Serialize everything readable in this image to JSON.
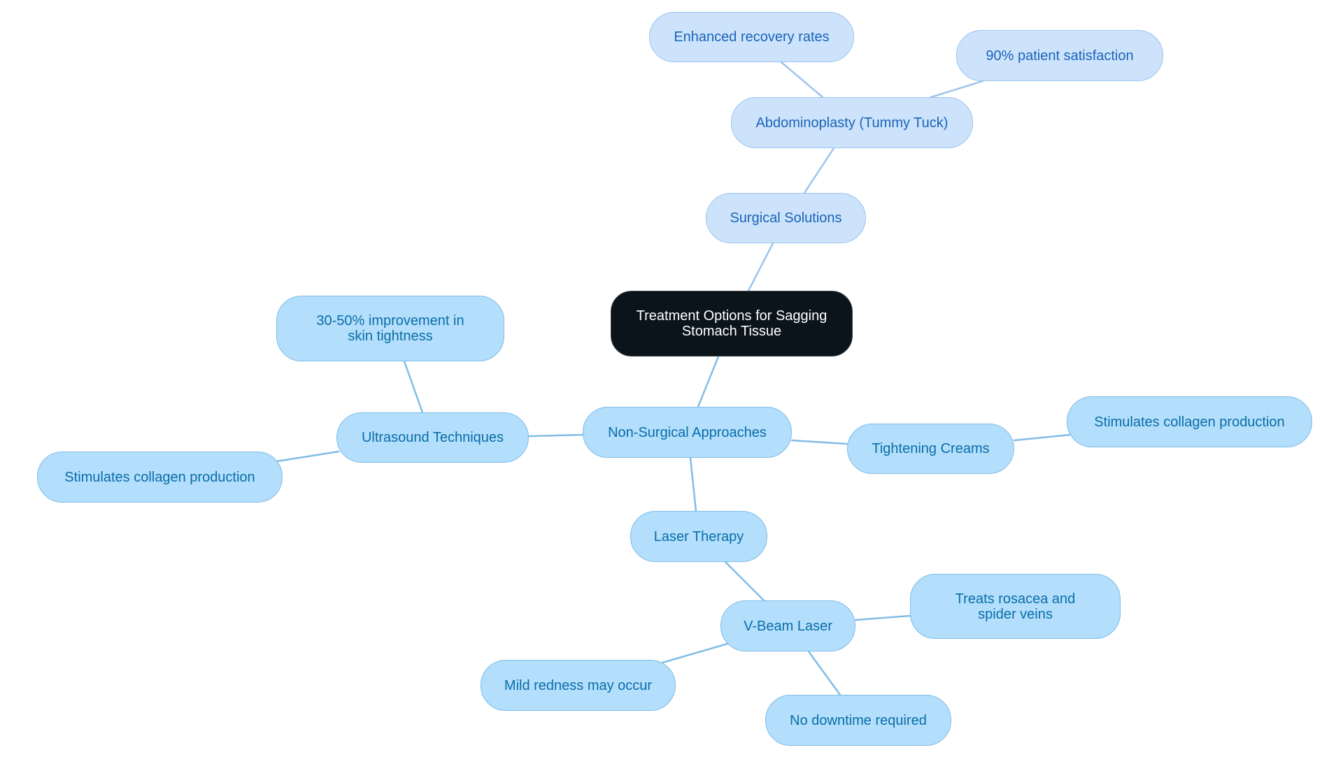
{
  "colors": {
    "root_fill": "#0b141b",
    "root_text": "#ffffff",
    "surgical_fill": "#cce3fb",
    "surgical_border": "#9ec4ee",
    "surgical_text": "#1b63b8",
    "surgical_edge": "#9ec4ee",
    "nonsurgical_fill": "#b3defc",
    "nonsurgical_border": "#81bde6",
    "nonsurgical_text": "#0a6ea8",
    "nonsurgical_edge": "#81bde6"
  },
  "mindmap": {
    "root": "Treatment Options for Sagging Stomach Tissue",
    "nodes": {
      "surgical": "Surgical Solutions",
      "abdominoplasty": "Abdominoplasty (Tummy Tuck)",
      "enhanced_recovery": "Enhanced recovery rates",
      "patient_satisfaction": "90% patient satisfaction",
      "non_surgical": "Non-Surgical Approaches",
      "ultrasound": "Ultrasound Techniques",
      "skin_tightness": "30-50% improvement in skin tightness",
      "ultrasound_collagen": "Stimulates collagen production",
      "tightening_creams": "Tightening Creams",
      "creams_collagen": "Stimulates collagen production",
      "laser_therapy": "Laser Therapy",
      "vbeam": "V-Beam Laser",
      "rosacea": "Treats rosacea and spider veins",
      "mild_redness": "Mild redness may occur",
      "no_downtime": "No downtime required"
    }
  }
}
